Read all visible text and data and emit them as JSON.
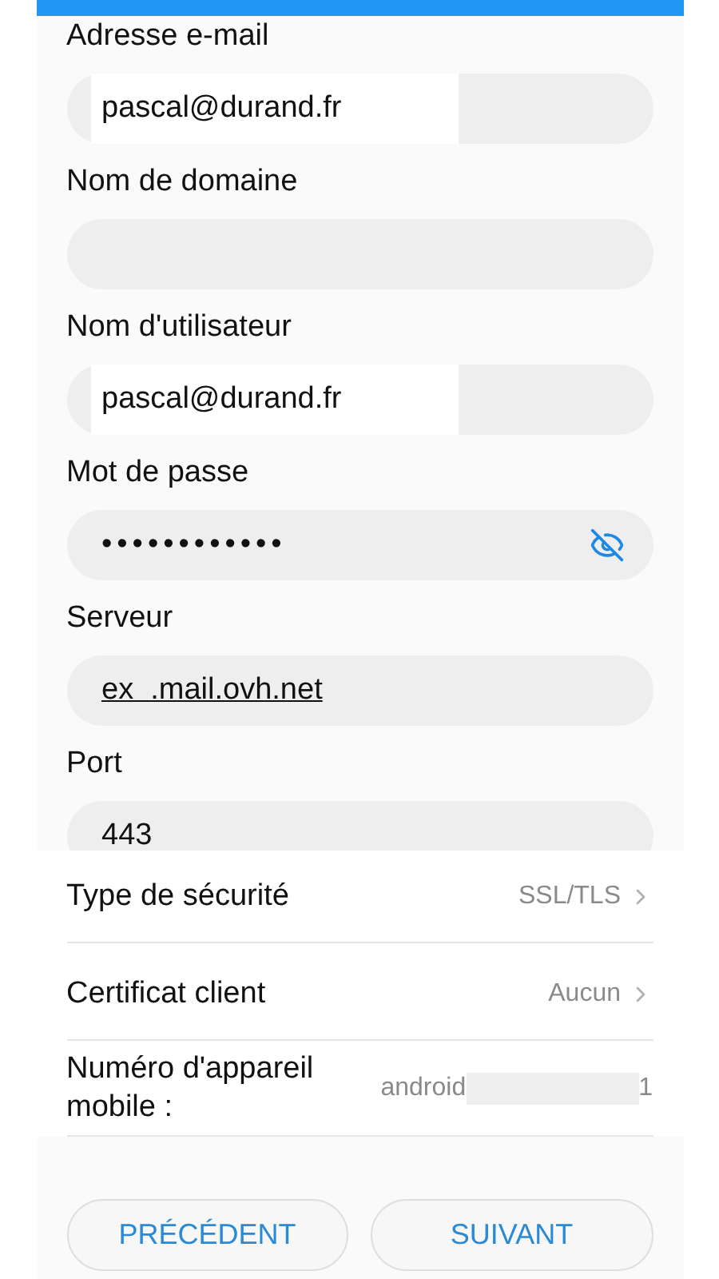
{
  "fields": [
    {
      "label": "Adresse e-mail",
      "kind": "text",
      "value": "pascal@durand.fr",
      "redacted": true
    },
    {
      "label": "Nom de domaine",
      "kind": "text"
    },
    {
      "label": "Nom d'utilisateur",
      "kind": "text",
      "value": "pascal@durand.fr",
      "redacted": true
    },
    {
      "label": "Mot de passe",
      "kind": "password",
      "value": "••••••••••••",
      "redacted": false
    },
    {
      "label": "Serveur",
      "kind": "link",
      "value": "ex  .mail.ovh.net",
      "redacted": false
    },
    {
      "label": "Port",
      "kind": "text",
      "value": "443",
      "redacted": false
    }
  ],
  "settings": [
    {
      "label": "Type de sécurité",
      "value": "SSL/TLS",
      "kind": "chevron"
    },
    {
      "label": "Certificat client",
      "value": "Aucun",
      "kind": "chevron"
    },
    {
      "label": "Numéro d'appareil mobile :",
      "value": "android",
      "value_end": "1",
      "kind": "masked"
    }
  ],
  "buttons": [
    "PRÉCÉDENT",
    "SUIVANT"
  ]
}
